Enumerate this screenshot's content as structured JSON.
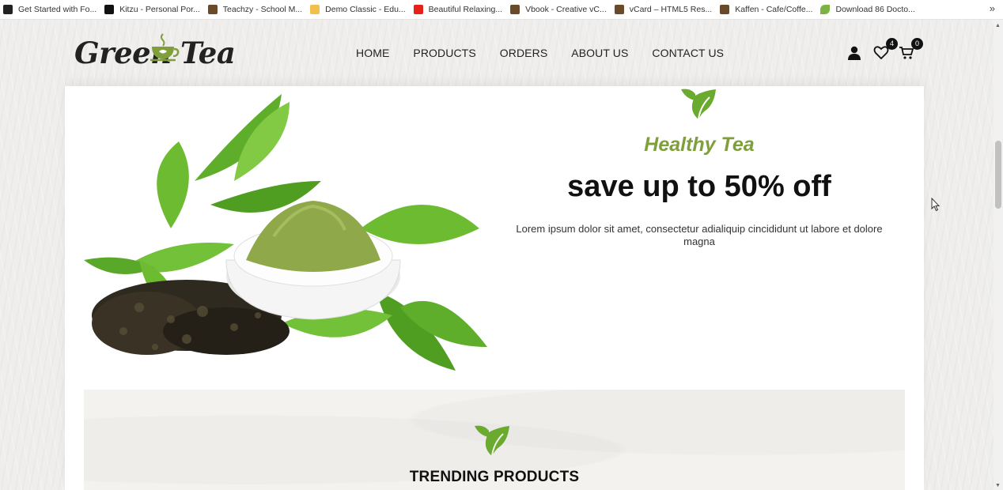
{
  "bookmarks": {
    "items": [
      {
        "label": "Get Started with Fo...",
        "icon": "bookmark-favicon-dark",
        "color": "#222222"
      },
      {
        "label": "Kitzu - Personal Por...",
        "icon": "bookmark-favicon-dark",
        "color": "#111111"
      },
      {
        "label": "Teachzy - School M...",
        "icon": "bookmark-favicon-brown",
        "color": "#6b4a2a"
      },
      {
        "label": "Demo Classic - Edu...",
        "icon": "bookmark-favicon-yellow",
        "color": "#f2c04a"
      },
      {
        "label": "Beautiful Relaxing...",
        "icon": "youtube-icon",
        "color": "#e62117"
      },
      {
        "label": "Vbook - Creative vC...",
        "icon": "bookmark-favicon-brown",
        "color": "#6b4a2a"
      },
      {
        "label": "vCard – HTML5 Res...",
        "icon": "bookmark-favicon-brown",
        "color": "#6b4a2a"
      },
      {
        "label": "Kaffen - Cafe/Coffe...",
        "icon": "bookmark-favicon-brown",
        "color": "#6b4a2a"
      },
      {
        "label": "Download 86 Docto...",
        "icon": "leaf-favicon",
        "color": "#7cb342"
      }
    ],
    "more": "»"
  },
  "header": {
    "logo": {
      "word1": "Green",
      "word2": "Tea"
    },
    "nav": [
      "HOME",
      "PRODUCTS",
      "ORDERS",
      "ABOUT US",
      "CONTACT US"
    ],
    "wishlist_count": "4",
    "cart_count": "0"
  },
  "hero": {
    "subtitle": "Healthy Tea",
    "title": "save up to 50% off",
    "description": "Lorem ipsum dolor sit amet, consectetur adialiquip cincididunt ut labore et dolore magna"
  },
  "trending": {
    "title": "TRENDING PRODUCTS"
  },
  "colors": {
    "accent_green": "#7f9f3a",
    "leaf_green": "#6aaa2e",
    "text_dark": "#111111"
  }
}
